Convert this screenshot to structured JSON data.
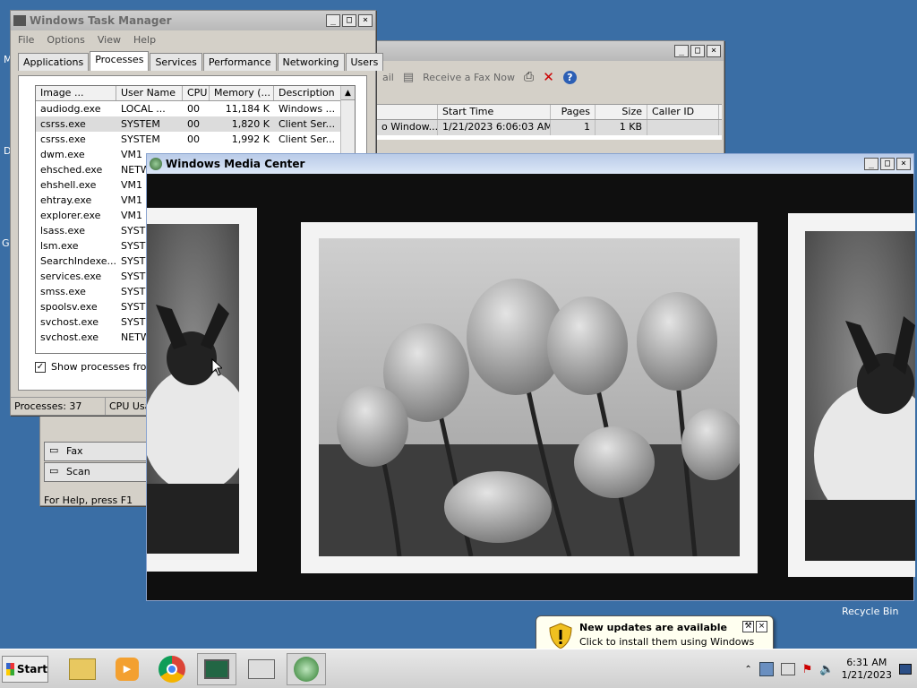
{
  "desktop": {
    "side_glyphs": [
      "M",
      "D",
      "G"
    ],
    "recycle_bin": "Recycle Bin"
  },
  "task_manager": {
    "title": "Windows Task Manager",
    "menu": [
      "File",
      "Options",
      "View",
      "Help"
    ],
    "tabs": [
      "Applications",
      "Processes",
      "Services",
      "Performance",
      "Networking",
      "Users"
    ],
    "selected_tab": "Processes",
    "columns": [
      "Image ...",
      "User Name",
      "CPU",
      "Memory (...",
      "Description"
    ],
    "rows": [
      [
        "audiodg.exe",
        "LOCAL ...",
        "00",
        "11,184 K",
        "Windows ..."
      ],
      [
        "csrss.exe",
        "SYSTEM",
        "00",
        "1,820 K",
        "Client Ser..."
      ],
      [
        "csrss.exe",
        "SYSTEM",
        "00",
        "1,992 K",
        "Client Ser..."
      ],
      [
        "dwm.exe",
        "VM1",
        "",
        "",
        ""
      ],
      [
        "ehsched.exe",
        "NETW",
        "",
        "",
        ""
      ],
      [
        "ehshell.exe",
        "VM1",
        "",
        "",
        ""
      ],
      [
        "ehtray.exe",
        "VM1",
        "",
        "",
        ""
      ],
      [
        "explorer.exe",
        "VM1",
        "",
        "",
        ""
      ],
      [
        "lsass.exe",
        "SYSTE",
        "",
        "",
        ""
      ],
      [
        "lsm.exe",
        "SYSTE",
        "",
        "",
        ""
      ],
      [
        "SearchIndexe...",
        "SYSTE",
        "",
        "",
        ""
      ],
      [
        "services.exe",
        "SYSTE",
        "",
        "",
        ""
      ],
      [
        "smss.exe",
        "SYSTE",
        "",
        "",
        ""
      ],
      [
        "spoolsv.exe",
        "SYSTE",
        "",
        "",
        ""
      ],
      [
        "svchost.exe",
        "SYSTE",
        "",
        "",
        ""
      ],
      [
        "svchost.exe",
        "NETW",
        "",
        "",
        ""
      ]
    ],
    "selected_row": 1,
    "show_all_label": "Show processes from a",
    "status_processes": "Processes: 37",
    "status_cpu": "CPU Usa"
  },
  "fax_window": {
    "toolbar_items": [
      "ail",
      "Receive a Fax Now"
    ],
    "columns": [
      "",
      "Start Time",
      "Pages",
      "Size",
      "Caller ID"
    ],
    "rows": [
      [
        "o Window...",
        "1/21/2023 6:06:03 AM",
        "1",
        "1 KB",
        ""
      ]
    ],
    "side_items": [
      "Fax",
      "Scan"
    ],
    "help_text": "For Help, press F1"
  },
  "media_center": {
    "title": "Windows Media Center"
  },
  "taskbar": {
    "start_label": "Start",
    "time": "6:31 AM",
    "date": "1/21/2023"
  },
  "notification": {
    "title": "New updates are available",
    "body": "Click to install them using Windows Update."
  },
  "colors": {
    "desktop": "#3a6ea5",
    "active_title": "#2a5fb0"
  }
}
